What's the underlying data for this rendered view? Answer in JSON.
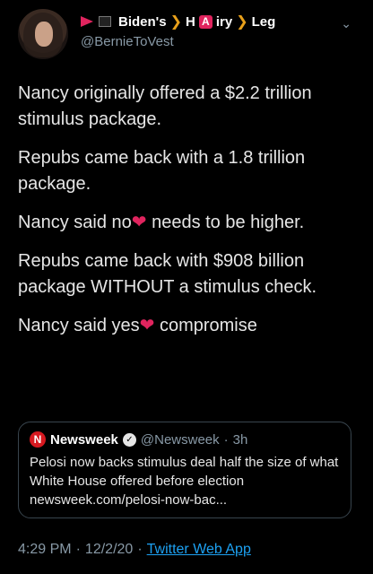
{
  "author": {
    "display_name_part1": "Biden's",
    "display_name_h": "H",
    "display_name_a": "A",
    "display_name_iry": "iry",
    "display_name_leg": "Leg",
    "arrow": "❯",
    "handle": "@BernieToVest"
  },
  "tweet": {
    "line1": "Nancy originally offered a $2.2 trillion stimulus package.",
    "line2": "Repubs came back with a 1.8 trillion package.",
    "line3_a": "Nancy said no",
    "line3_b": " needs to be higher.",
    "line4": "Repubs came back with $908 billion package WITHOUT a stimulus check.",
    "line5_a": "Nancy said yes",
    "line5_b": " compromise",
    "heart": "❤"
  },
  "quote": {
    "logo": "N",
    "name": "Newsweek",
    "verified": "✓",
    "handle": "@Newsweek",
    "sep": "·",
    "time": "3h",
    "text": "Pelosi now backs stimulus deal half the size of what White House offered before election newsweek.com/pelosi-now-bac..."
  },
  "meta": {
    "time": "4:29 PM",
    "sep1": "·",
    "date": "12/2/20",
    "sep2": "·",
    "source": "Twitter Web App"
  },
  "icons": {
    "chevron": "⌄"
  },
  "colors": {
    "background": "#000000",
    "accent_link": "#1da1f2",
    "heart": "#e0245e",
    "muted": "#8899a6"
  }
}
